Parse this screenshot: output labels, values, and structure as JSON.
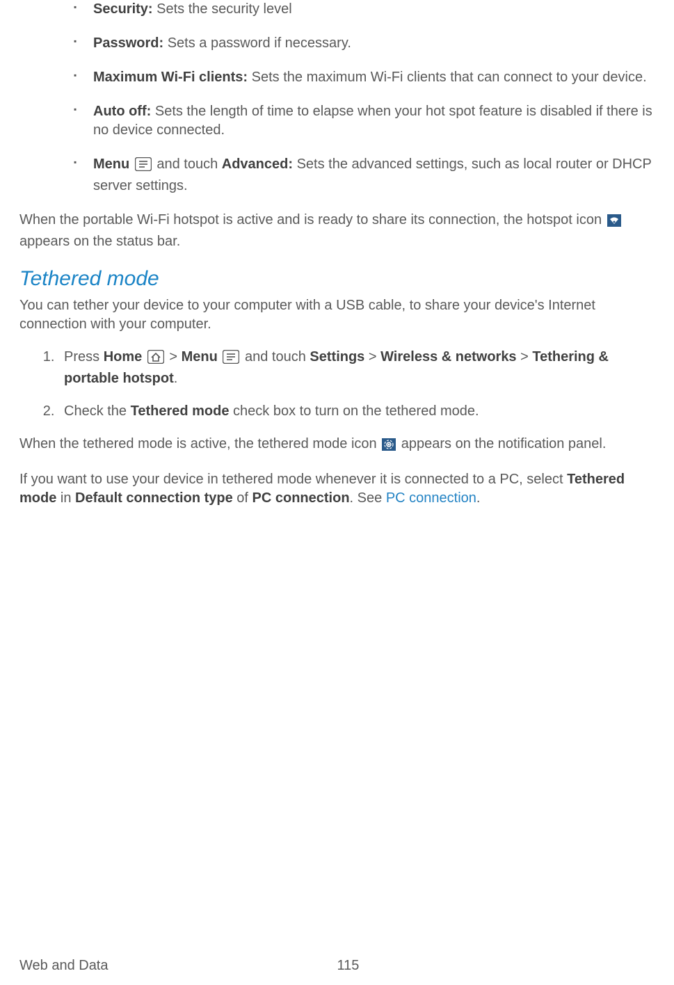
{
  "bullets": {
    "security": {
      "label": "Security:",
      "desc": " Sets the security level"
    },
    "password": {
      "label": "Password:",
      "desc": " Sets a password if necessary."
    },
    "maxwifi": {
      "label": "Maximum Wi-Fi clients:",
      "desc": " Sets the maximum Wi-Fi clients that can connect to your device."
    },
    "autooff": {
      "label": "Auto off:",
      "desc": " Sets the length of time to elapse when your hot spot feature is disabled if there is no device connected."
    },
    "menu": {
      "label": "Menu",
      "touch": " and touch ",
      "advanced": "Advanced:",
      "desc": " Sets the advanced settings, such as local router or DHCP server settings."
    }
  },
  "hotspot_para": {
    "pre": "When the portable Wi-Fi hotspot is active and is ready to share its connection, the hotspot icon ",
    "post": " appears on the status bar."
  },
  "tethered": {
    "heading": "Tethered mode",
    "intro": "You can tether your device to your computer with a USB cable, to share your device's Internet connection with your computer.",
    "step1": {
      "press": "Press ",
      "home": "Home",
      "gt1": " > ",
      "menu": "Menu",
      "touch": " and touch ",
      "settings": "Settings",
      "gt2": " > ",
      "wireless": "Wireless & networks",
      "gt3": " > ",
      "tether": "Tethering & portable hotspot",
      "dot": "."
    },
    "step2": {
      "pre": "Check the ",
      "bold": "Tethered mode",
      "post": " check box to turn on the tethered mode."
    },
    "active_para": {
      "pre": "When the tethered mode is active, the tethered mode icon ",
      "post": " appears on the notification panel."
    },
    "default_para": {
      "pre": "If you want to use your device in tethered mode whenever it is connected to a PC, select ",
      "b1": "Tethered mode",
      "mid1": " in ",
      "b2": "Default connection type",
      "mid2": " of ",
      "b3": "PC connection",
      "mid3": ". See ",
      "link": "PC connection",
      "end": "."
    }
  },
  "footer": {
    "section": "Web and Data",
    "page": "115"
  }
}
